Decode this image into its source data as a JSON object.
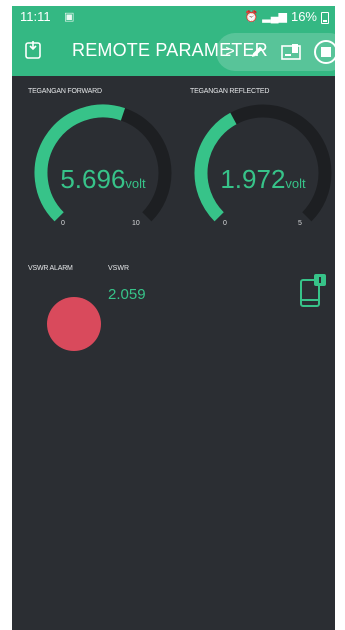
{
  "status_bar": {
    "time": "11:11",
    "battery": "16%"
  },
  "app_bar": {
    "title": "REMOTE PARAMETER",
    "chevron": ">"
  },
  "gauges": [
    {
      "label": "TEGANGAN FORWARD",
      "value": "5.696",
      "unit": "volt",
      "min": "0",
      "max": "10",
      "level": 0.5696
    },
    {
      "label": "TEGANGAN REFLECTED",
      "value": "1.972",
      "unit": "volt",
      "min": "0",
      "max": "5",
      "level": 0.3944
    }
  ],
  "led": {
    "label": "VSWR ALARM",
    "state": "on",
    "color": "#d94a5c"
  },
  "vswr": {
    "label": "VSWR",
    "value": "2.059"
  },
  "colors": {
    "accent": "#34b883",
    "background": "#2b2e33",
    "gauge_track": "#1d1f22",
    "gauge_fill": "#37c389"
  },
  "icons": {
    "back": "exit-icon",
    "edit": "pencil-icon",
    "devices": "devices-icon",
    "stop": "stop-icon",
    "notification": "phone-notification-icon"
  }
}
